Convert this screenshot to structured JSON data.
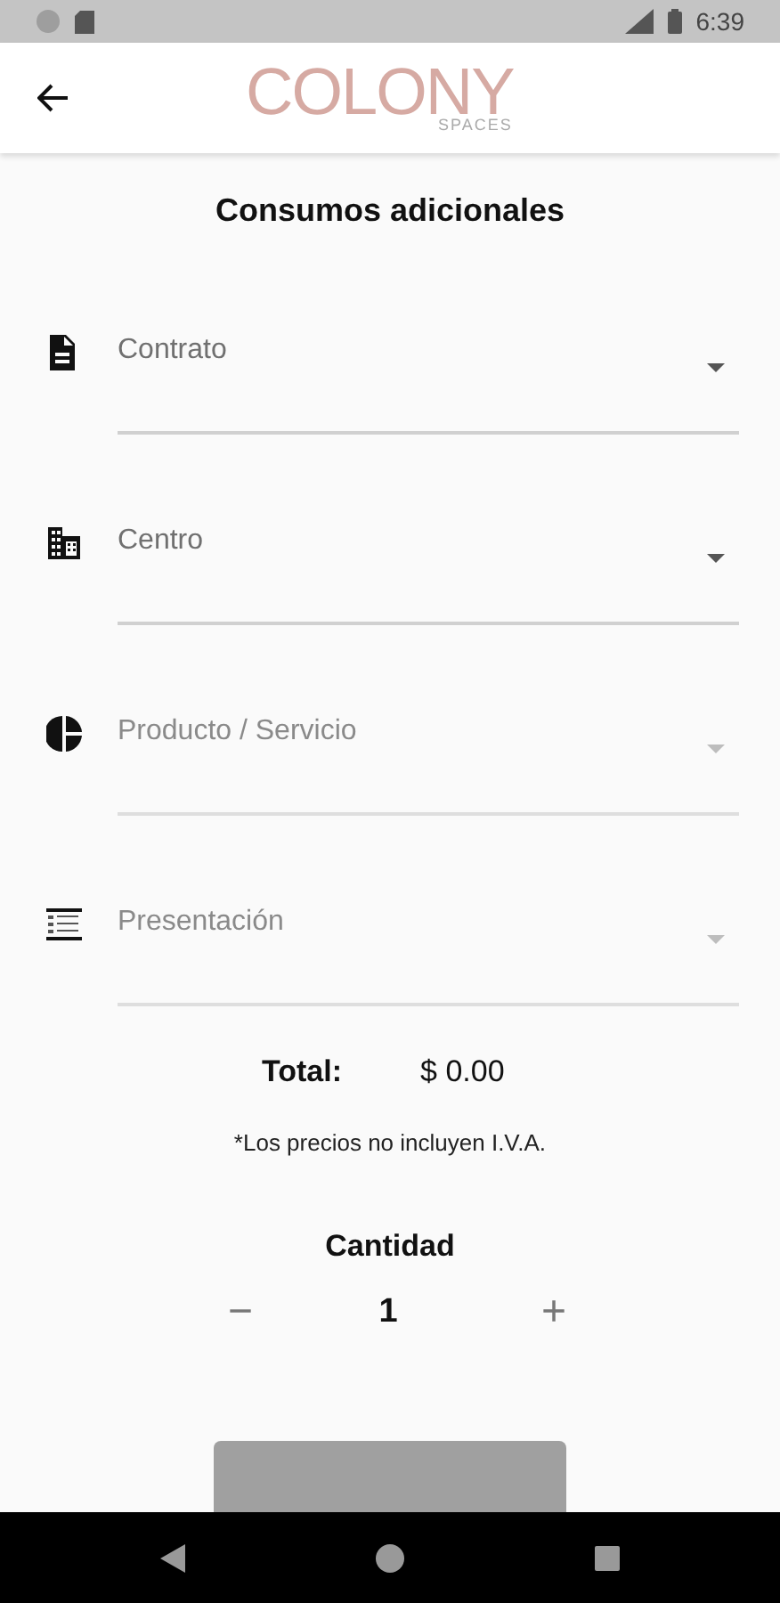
{
  "status_bar": {
    "time": "6:39"
  },
  "app_bar": {
    "logo": "COLONY",
    "logo_subtitle": "SPACES"
  },
  "title": "Consumos adicionales",
  "fields": [
    {
      "kind": "document",
      "label": "Contrato",
      "disabled": false
    },
    {
      "kind": "building",
      "label": "Centro",
      "disabled": false
    },
    {
      "kind": "pie",
      "label": "Producto / Servicio",
      "disabled": true
    },
    {
      "kind": "list",
      "label": "Presentación",
      "disabled": true
    }
  ],
  "total": {
    "label": "Total:",
    "value": "$ 0.00"
  },
  "note": "*Los precios no incluyen I.V.A.",
  "quantity": {
    "label": "Cantidad",
    "decrement": "−",
    "value": "1",
    "increment": "+"
  },
  "submit_button": {
    "disabled": true
  }
}
